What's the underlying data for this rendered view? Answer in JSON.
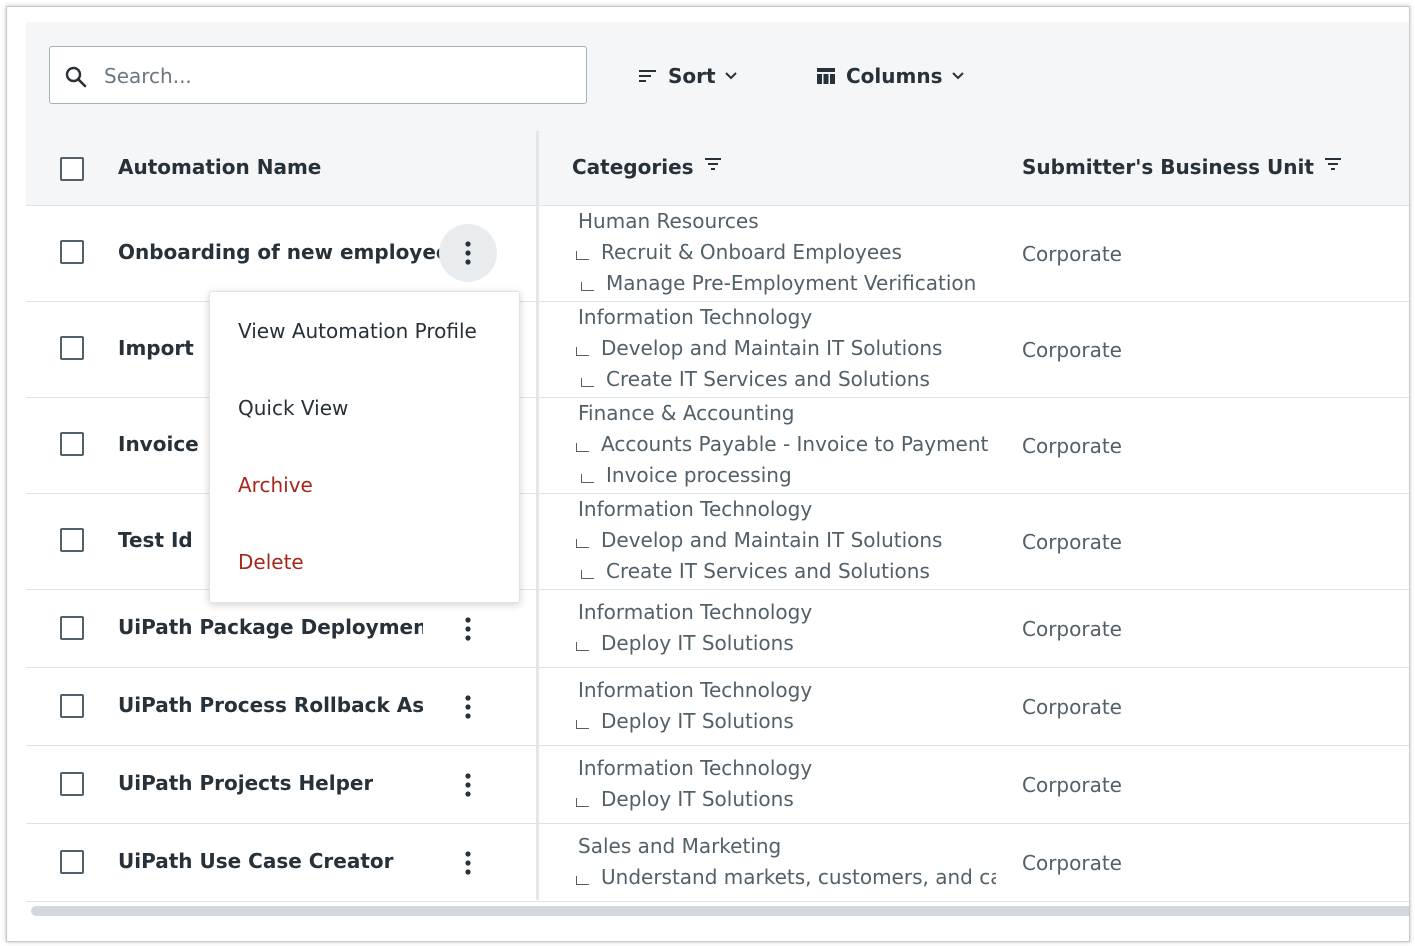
{
  "search": {
    "placeholder": "Search..."
  },
  "toolbar": {
    "sort_label": "Sort",
    "columns_label": "Columns"
  },
  "columns": {
    "name": "Automation Name",
    "categories": "Categories",
    "business_unit": "Submitter's Business Unit"
  },
  "rows": [
    {
      "name": "Onboarding of new employee",
      "cat": [
        "Human Resources",
        "Recruit & Onboard Employees",
        "Manage Pre-Employment Verification"
      ],
      "bu": "Corporate"
    },
    {
      "name": "Import",
      "cat": [
        "Information Technology",
        "Develop and Maintain IT Solutions",
        "Create IT Services and Solutions"
      ],
      "bu": "Corporate"
    },
    {
      "name": "Invoice",
      "cat": [
        "Finance & Accounting",
        "Accounts Payable - Invoice to Payment",
        "Invoice processing"
      ],
      "bu": "Corporate"
    },
    {
      "name": "Test Id",
      "cat": [
        "Information Technology",
        "Develop and Maintain IT Solutions",
        "Create IT Services and Solutions"
      ],
      "bu": "Corporate"
    },
    {
      "name": "UiPath Package Deploymen...",
      "cat": [
        "Information Technology",
        "Deploy IT Solutions"
      ],
      "bu": "Corporate"
    },
    {
      "name": "UiPath Process Rollback Ass...",
      "cat": [
        "Information Technology",
        "Deploy IT Solutions"
      ],
      "bu": "Corporate"
    },
    {
      "name": "UiPath Projects Helper",
      "cat": [
        "Information Technology",
        "Deploy IT Solutions"
      ],
      "bu": "Corporate"
    },
    {
      "name": "UiPath Use Case Creator",
      "cat": [
        "Sales and Marketing",
        "Understand markets, customers, and ca"
      ],
      "bu": "Corporate"
    }
  ],
  "context_menu": {
    "items": [
      {
        "label": "View Automation Profile"
      },
      {
        "label": "Quick View"
      },
      {
        "label": "Archive"
      },
      {
        "label": "Delete"
      }
    ]
  },
  "colors": {
    "danger": "#a6281c",
    "text": "#273139",
    "muted": "#526069",
    "header_bg": "#f4f6f8"
  }
}
